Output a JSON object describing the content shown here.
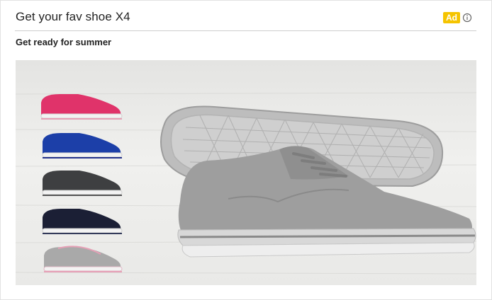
{
  "ad": {
    "headline": "Get your fav shoe X4",
    "badge": "Ad",
    "subline": "Get ready for summer",
    "info_icon": "info-circle-icon",
    "colors": {
      "badge_bg": "#f5c400",
      "shoe_pink": "#e0336a",
      "shoe_blue": "#1c3fa8",
      "shoe_charcoal": "#3e3f41",
      "shoe_navy": "#1b1f35",
      "shoe_grey": "#a9a9a9"
    }
  }
}
